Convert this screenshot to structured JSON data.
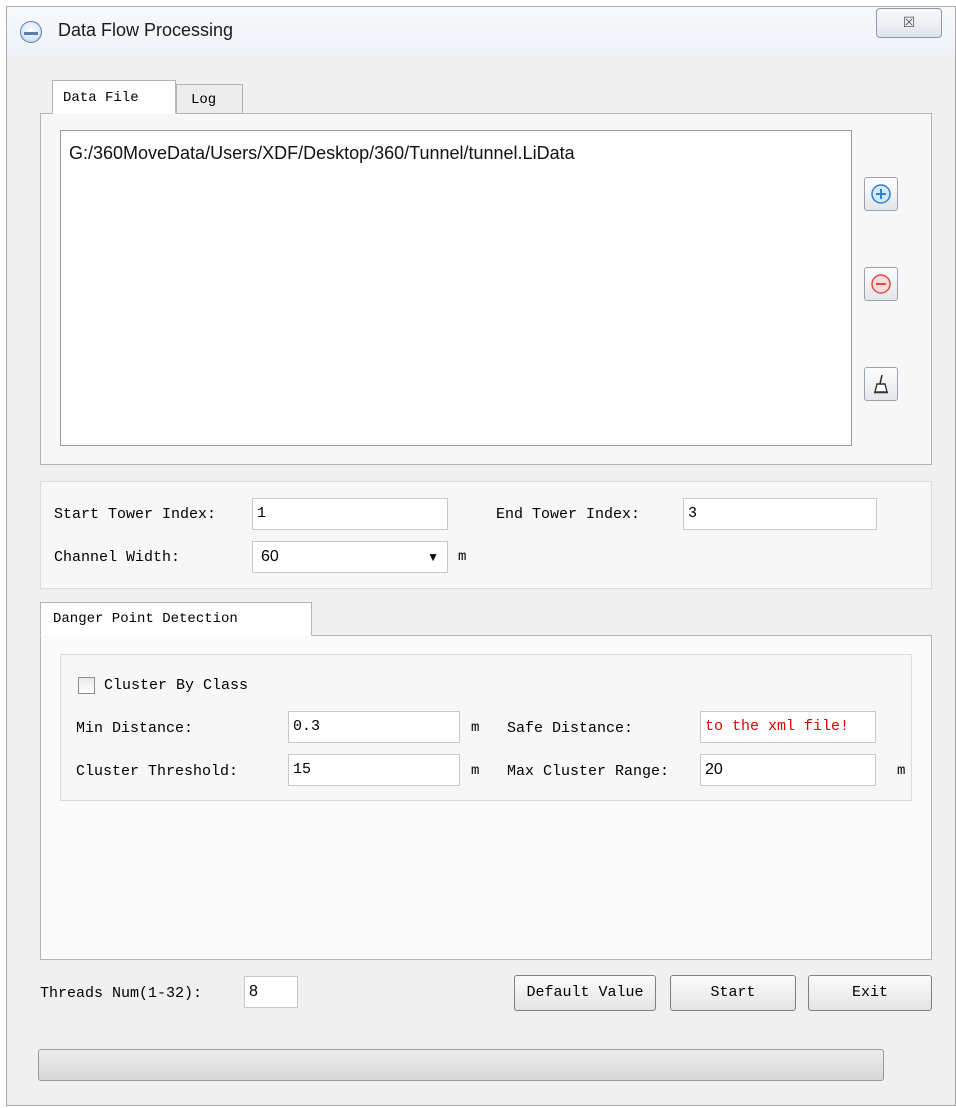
{
  "window": {
    "title": "Data Flow Processing",
    "close_label": "☒"
  },
  "tabs_top": [
    {
      "label": "Data File"
    },
    {
      "label": "Log"
    }
  ],
  "file_list": {
    "items": [
      "G:/360MoveData/Users/XDF/Desktop/360/Tunnel/tunnel.LiData"
    ]
  },
  "side_buttons": {
    "add_icon": "add-circle-icon",
    "remove_icon": "remove-circle-icon",
    "clear_icon": "broom-icon"
  },
  "tower": {
    "start_label": "Start Tower Index:",
    "start_value": "1",
    "end_label": "End Tower Index:",
    "end_value": "3",
    "channel_label": "Channel Width:",
    "channel_value": "60",
    "channel_unit": "m"
  },
  "detection": {
    "tab_label": "Danger Point Detection",
    "cluster_by_class_label": "Cluster By Class",
    "cluster_by_class_checked": false,
    "min_distance_label": "Min Distance:",
    "min_distance_value": "0.3",
    "min_distance_unit": "m",
    "safe_distance_label": "Safe Distance:",
    "safe_distance_value": "to the xml file!",
    "cluster_threshold_label": "Cluster Threshold:",
    "cluster_threshold_value": "15",
    "cluster_threshold_unit": "m",
    "max_cluster_range_label": "Max Cluster Range:",
    "max_cluster_range_value": "20",
    "max_cluster_range_unit": "m"
  },
  "footer": {
    "threads_label": "Threads Num(1-32):",
    "threads_value": "8",
    "default_button": "Default Value",
    "start_button": "Start",
    "exit_button": "Exit",
    "progress": 0
  },
  "colors": {
    "warning_text": "#e00000",
    "accent_blue": "#2f7fd6",
    "accent_red": "#e24a4a"
  }
}
